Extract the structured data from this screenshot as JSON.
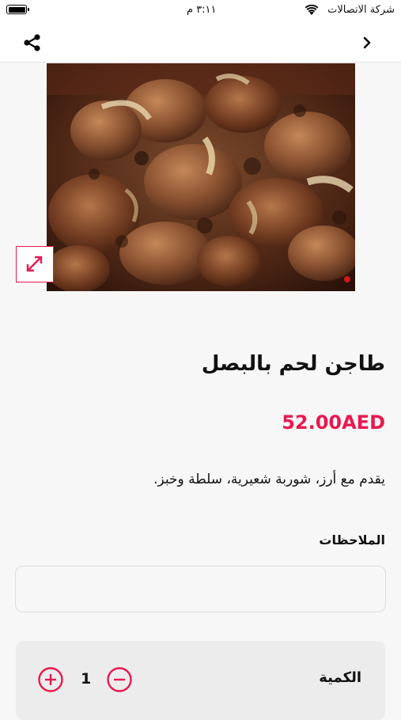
{
  "status_bar": {
    "carrier": "شركة الاتصالات",
    "time": "٣:١١ م"
  },
  "nav": {
    "share_icon": "share-icon",
    "back_icon": "chevron-right-icon"
  },
  "product": {
    "title": "طاجن لحم بالبصل",
    "price": "52.00AED",
    "description": "يقدم مع أرز، شوربة شعيرية، سلطة وخبز.",
    "image_alt": "meat-tajine-photo"
  },
  "notes": {
    "label": "الملاحظات",
    "value": "",
    "placeholder": ""
  },
  "quantity": {
    "label": "الكمية",
    "value": "1"
  },
  "colors": {
    "accent": "#e8194f",
    "background": "#f7f7f7",
    "surface": "#ffffff"
  }
}
